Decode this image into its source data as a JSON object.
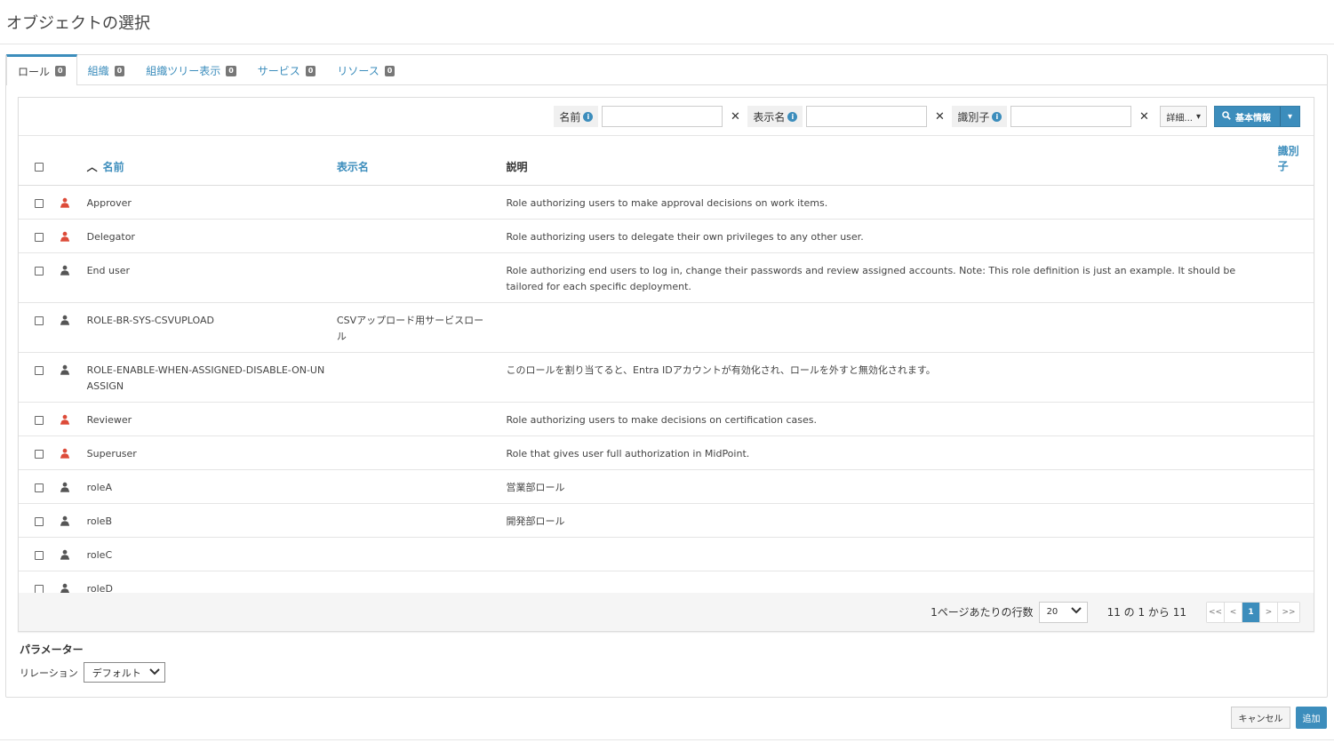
{
  "page": {
    "title": "オブジェクトの選択"
  },
  "tabs": [
    {
      "label": "ロール",
      "count": "0"
    },
    {
      "label": "組織",
      "count": "0"
    },
    {
      "label": "組織ツリー表示",
      "count": "0"
    },
    {
      "label": "サービス",
      "count": "0"
    },
    {
      "label": "リソース",
      "count": "0"
    }
  ],
  "search": {
    "name_label": "名前",
    "display_name_label": "表示名",
    "identifier_label": "識別子",
    "more_label": "詳細...",
    "basic_label": "基本情報"
  },
  "table": {
    "headers": {
      "name": "名前",
      "display_name": "表示名",
      "description": "説明",
      "identifier": "識別子"
    },
    "rows": [
      {
        "name": "Approver",
        "display_name": "",
        "description": "Role authorizing users to make approval decisions on work items.",
        "icon_color": "#dd4b39"
      },
      {
        "name": "Delegator",
        "display_name": "",
        "description": "Role authorizing users to delegate their own privileges to any other user.",
        "icon_color": "#dd4b39"
      },
      {
        "name": "End user",
        "display_name": "",
        "description": "Role authorizing end users to log in, change their passwords and review assigned accounts. Note: This role definition is just an example. It should be tailored for each specific deployment.",
        "icon_color": "#555555"
      },
      {
        "name": "ROLE-BR-SYS-CSVUPLOAD",
        "display_name": "CSVアップロード用サービスロール",
        "description": "",
        "icon_color": "#555555"
      },
      {
        "name": "ROLE-ENABLE-WHEN-ASSIGNED-DISABLE-ON-UNASSIGN",
        "display_name": "",
        "description": "このロールを割り当てると、Entra IDアカウントが有効化され、ロールを外すと無効化されます。",
        "icon_color": "#555555"
      },
      {
        "name": "Reviewer",
        "display_name": "",
        "description": "Role authorizing users to make decisions on certification cases.",
        "icon_color": "#dd4b39"
      },
      {
        "name": "Superuser",
        "display_name": "",
        "description": "Role that gives user full authorization in MidPoint.",
        "icon_color": "#dd4b39"
      },
      {
        "name": "roleA",
        "display_name": "",
        "description": "営業部ロール",
        "icon_color": "#555555"
      },
      {
        "name": "roleB",
        "display_name": "",
        "description": "開発部ロール",
        "icon_color": "#555555"
      },
      {
        "name": "roleC",
        "display_name": "",
        "description": "",
        "icon_color": "#555555"
      },
      {
        "name": "roleD",
        "display_name": "",
        "description": "",
        "icon_color": "#555555"
      }
    ]
  },
  "footer": {
    "rows_per_page_label": "1ページあたりの行数",
    "rows_per_page_value": "20",
    "count_text": "11 の 1 から 11",
    "pager": [
      "<<",
      "<",
      "1",
      ">",
      ">>"
    ],
    "current_page": "1"
  },
  "params": {
    "title": "パラメーター",
    "relation_label": "リレーション",
    "relation_value": "デフォルト"
  },
  "actions": {
    "cancel": "キャンセル",
    "add": "追加"
  },
  "colors": {
    "accent": "#3c8dbc",
    "danger": "#dd4b39"
  }
}
